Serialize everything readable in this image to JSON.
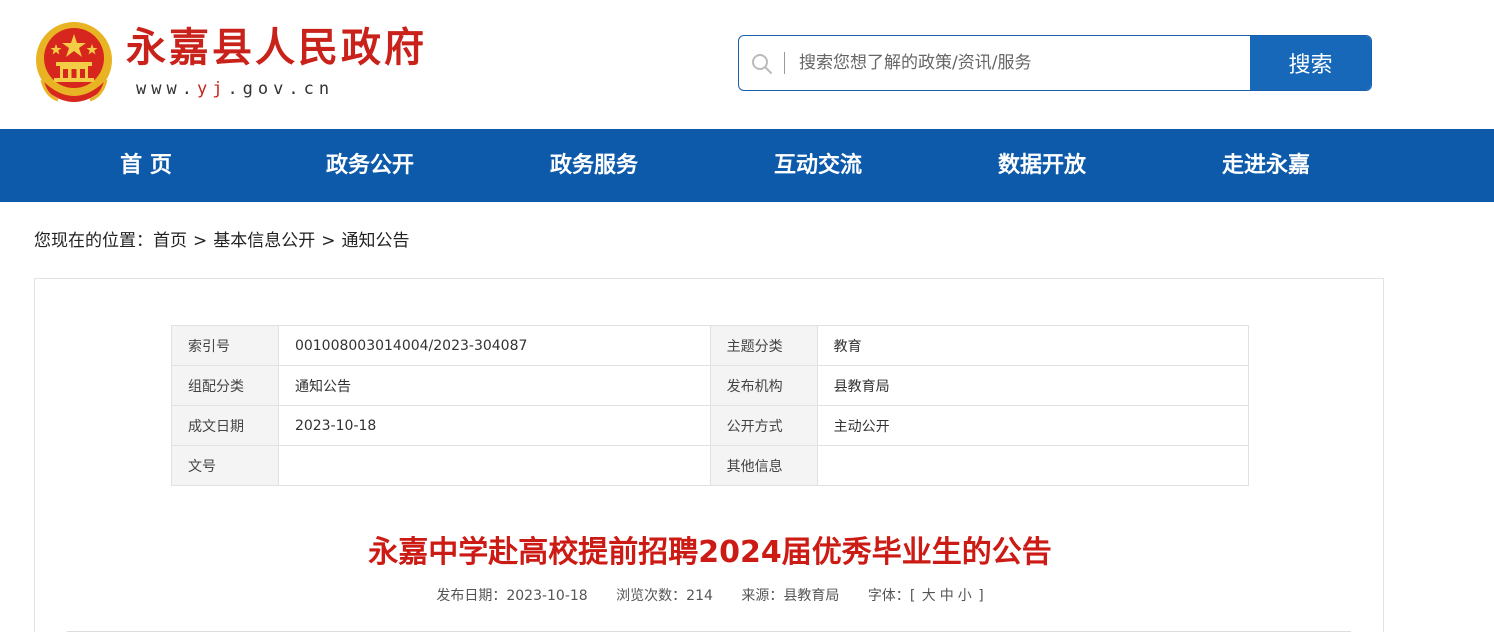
{
  "header": {
    "site_name": "永嘉县人民政府",
    "url_prefix": "www.",
    "url_highlight": "yj",
    "url_suffix": ".gov.cn",
    "search_placeholder": "搜索您想了解的政策/资讯/服务",
    "search_button": "搜索",
    "brand_color": "#c8221b"
  },
  "nav": {
    "color": "#0c5aa9",
    "items": [
      {
        "label": "首 页"
      },
      {
        "label": "政务公开"
      },
      {
        "label": "政务服务"
      },
      {
        "label": "互动交流"
      },
      {
        "label": "数据开放"
      },
      {
        "label": "走进永嘉"
      }
    ]
  },
  "breadcrumb": {
    "prefix": "您现在的位置：",
    "items": [
      "首页",
      "基本信息公开",
      "通知公告"
    ],
    "separator": ">"
  },
  "info": {
    "rows": [
      {
        "l1": "索引号",
        "v1": "001008003014004/2023-304087",
        "l2": "主题分类",
        "v2": "教育"
      },
      {
        "l1": "组配分类",
        "v1": "通知公告",
        "l2": "发布机构",
        "v2": "县教育局"
      },
      {
        "l1": "成文日期",
        "v1": "2023-10-18",
        "l2": "公开方式",
        "v2": "主动公开"
      },
      {
        "l1": "文号",
        "v1": "",
        "l2": "其他信息",
        "v2": ""
      }
    ]
  },
  "article": {
    "title": "永嘉中学赴高校提前招聘2024届优秀毕业生的公告",
    "date_label": "发布日期：",
    "date": "2023-10-18",
    "views_label": "浏览次数：",
    "views": "214",
    "source_label": "来源：",
    "source": "县教育局",
    "font_label": "字体：",
    "font_open": "[",
    "font_large": "大",
    "font_medium": "中",
    "font_small": "小",
    "font_close": "]",
    "title_color": "#cc1a14"
  }
}
